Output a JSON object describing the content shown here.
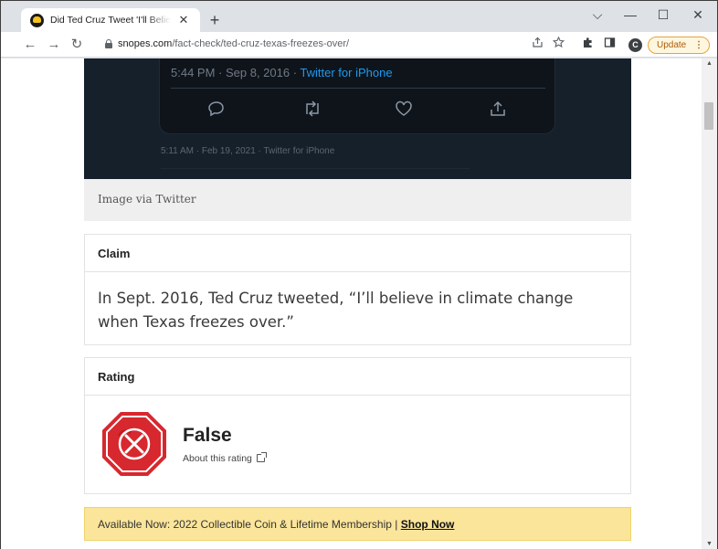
{
  "browser": {
    "tab": {
      "title": "Did Ted Cruz Tweet 'I'll Believe in Climate Change When Texas Freezes Over'?",
      "close": "✕"
    },
    "new_tab": "+",
    "window_controls": {
      "minimize": "—",
      "maximize": "☐",
      "close": "✕",
      "menu": "⌵"
    },
    "nav": {
      "back": "←",
      "forward": "→",
      "reload": "↻"
    },
    "url": {
      "host": "snopes.com",
      "path": "/fact-check/ted-cruz-texas-freezes-over/"
    },
    "profile_initial": "C",
    "update_label": "Update",
    "update_menu": "⋮",
    "icons": {
      "share": "share-icon",
      "star": "star-icon",
      "extensions": "puzzle-icon",
      "sidepanel": "sidepanel-icon"
    }
  },
  "tweet_image": {
    "time_text": "5:44 PM · Sep 8, 2016 · ",
    "source_text": "Twitter for iPhone",
    "meta_text": "5:11 AM · Feb 19, 2021 · Twitter for iPhone",
    "caption": "Image via Twitter"
  },
  "claim": {
    "heading": "Claim",
    "text": "In Sept. 2016, Ted Cruz tweeted, “I’ll believe in climate change when Texas freezes over.”"
  },
  "rating": {
    "heading": "Rating",
    "label": "False",
    "link": "About this rating",
    "badge_color": "#d7282f"
  },
  "promo": {
    "text": "Available Now: 2022 Collectible Coin & Lifetime Membership | ",
    "link": "Shop Now",
    "background": "#fbe59a"
  }
}
